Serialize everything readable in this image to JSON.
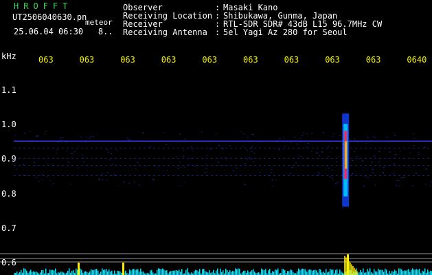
{
  "header": {
    "logo": "HROFFT",
    "filename": "UT2506040630.pn",
    "filename_suffix": "meteor",
    "timestamp": "25.06.04 06:30",
    "count": "8..",
    "observer_label": "Observer",
    "observer_value": "Masaki Kano",
    "location_label": "Receiving Location",
    "location_value": "Shibukawa, Gunma, Japan",
    "receiver_label": "Receiver",
    "receiver_value": "RTL-SDR SDR# 43dB L15 96.7MHz CW",
    "antenna_label": "Receiving Antenna",
    "antenna_value": "5el Yagi Az 280 for Seoul",
    "colon": ":"
  },
  "chart_data": {
    "type": "heatmap",
    "ylabel": "kHz",
    "y_ticks": [
      "1.1",
      "1.0",
      "0.9",
      "0.8",
      "0.7",
      "0.6"
    ],
    "y_range": [
      0.6,
      1.1
    ],
    "x_ticks": [
      "063",
      "063",
      "063",
      "063",
      "063",
      "063",
      "063",
      "063",
      "063",
      "0640"
    ],
    "background_color": "#000000",
    "noise_line_color": "#3344ff",
    "echo_color": "#ff2266",
    "level_line_color": "#ffffff",
    "level_bar_color": "#00e5ff",
    "level_spike_color": "#ffee00",
    "noise_lines_khz": [
      0.95,
      0.93,
      0.9,
      0.88,
      0.85
    ],
    "echo": {
      "time_fraction": 0.8,
      "freq_low_khz": 0.76,
      "freq_high_khz": 1.03,
      "peak_khz": 0.91
    }
  }
}
